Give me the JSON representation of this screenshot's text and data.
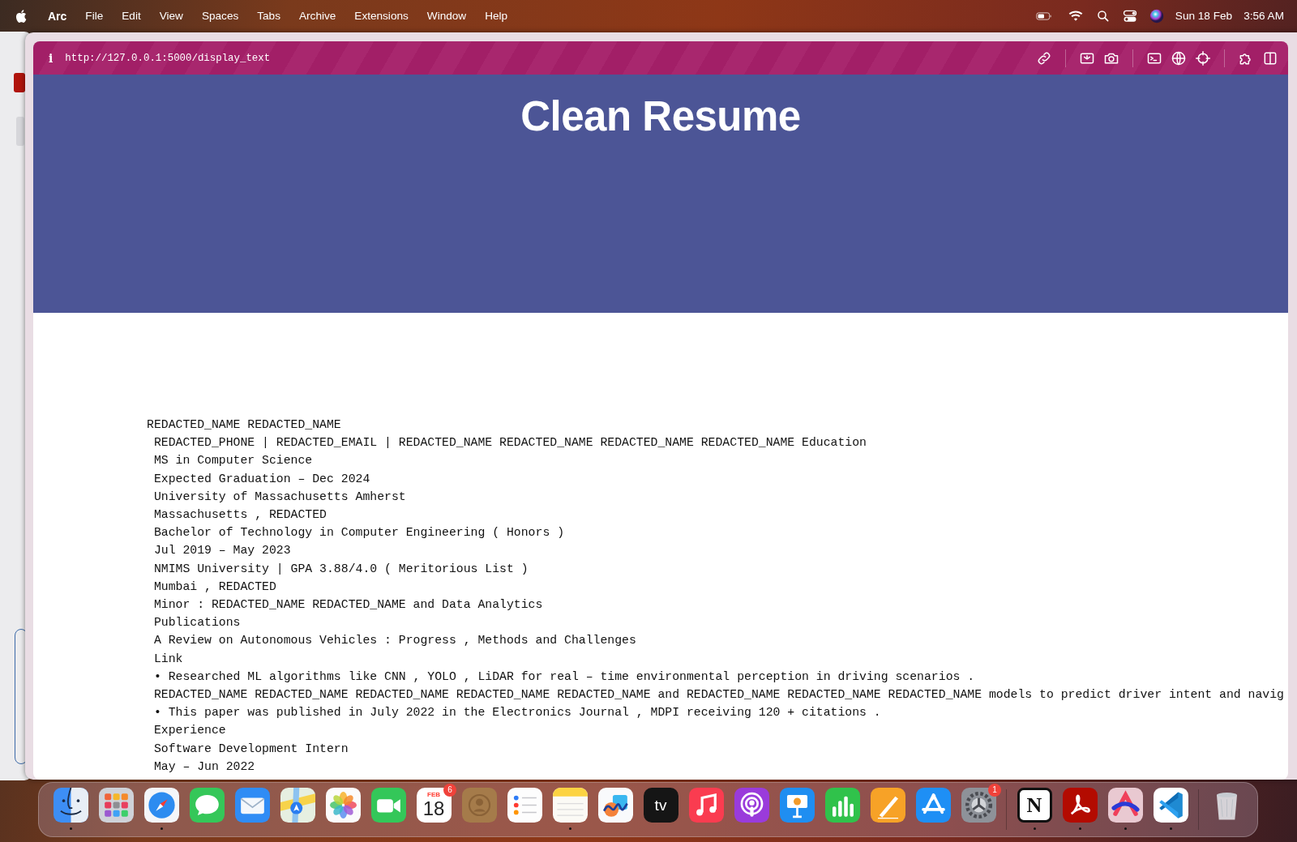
{
  "menu_bar": {
    "app": "Arc",
    "items": [
      "File",
      "Edit",
      "View",
      "Spaces",
      "Tabs",
      "Archive",
      "Extensions",
      "Window",
      "Help"
    ],
    "date": "Sun 18 Feb",
    "time": "3:56 AM"
  },
  "browser": {
    "info": "i",
    "url": "http://127.0.0.1:5000/display_text"
  },
  "page": {
    "title": "Clean Resume",
    "lines": [
      "REDACTED_NAME REDACTED_NAME",
      " REDACTED_PHONE | REDACTED_EMAIL | REDACTED_NAME REDACTED_NAME REDACTED_NAME REDACTED_NAME Education",
      " MS in Computer Science",
      " Expected Graduation – Dec 2024",
      " University of Massachusetts Amherst",
      " Massachusetts , REDACTED",
      " Bachelor of Technology in Computer Engineering ( Honors )",
      " Jul 2019 – May 2023",
      " NMIMS University | GPA 3.88/4.0 ( Meritorious List )",
      " Mumbai , REDACTED",
      " Minor : REDACTED_NAME REDACTED_NAME and Data Analytics",
      " Publications",
      " A Review on Autonomous Vehicles : Progress , Methods and Challenges",
      " Link",
      " • Researched ML algorithms like CNN , YOLO , LiDAR for real – time environmental perception in driving scenarios .",
      " REDACTED_NAME REDACTED_NAME REDACTED_NAME REDACTED_NAME REDACTED_NAME and REDACTED_NAME REDACTED_NAME REDACTED_NAME models to predict driver intent and navig",
      " • This paper was published in July 2022 in the Electronics Journal , MDPI receiving 120 + citations .",
      " Experience",
      " Software Development Intern",
      " May – Jun 2022"
    ]
  },
  "dock": {
    "items": [
      {
        "kind": "finder",
        "running": true
      },
      {
        "kind": "launchpad",
        "running": false
      },
      {
        "kind": "safari",
        "running": true
      },
      {
        "kind": "messages",
        "running": false
      },
      {
        "kind": "mail",
        "running": false
      },
      {
        "kind": "maps",
        "running": false
      },
      {
        "kind": "photos",
        "running": false
      },
      {
        "kind": "facetime",
        "running": false
      },
      {
        "kind": "calendar",
        "running": false,
        "month": "FEB",
        "day": "18",
        "badge": "6"
      },
      {
        "kind": "contacts",
        "running": false
      },
      {
        "kind": "reminders",
        "running": false
      },
      {
        "kind": "notes",
        "running": true
      },
      {
        "kind": "freeform",
        "running": false
      },
      {
        "kind": "tv",
        "running": false,
        "label": "tv"
      },
      {
        "kind": "music",
        "running": false
      },
      {
        "kind": "podcasts",
        "running": false
      },
      {
        "kind": "keynote",
        "running": false
      },
      {
        "kind": "numbers",
        "running": false
      },
      {
        "kind": "pages",
        "running": false
      },
      {
        "kind": "appstore",
        "running": false
      },
      {
        "kind": "settings",
        "running": false,
        "badge": "1"
      },
      {
        "kind": "separator"
      },
      {
        "kind": "notion",
        "running": true,
        "label": "N"
      },
      {
        "kind": "acrobat",
        "running": true
      },
      {
        "kind": "arc",
        "running": true
      },
      {
        "kind": "vscode",
        "running": true
      },
      {
        "kind": "separator"
      },
      {
        "kind": "trash",
        "running": false
      }
    ]
  }
}
